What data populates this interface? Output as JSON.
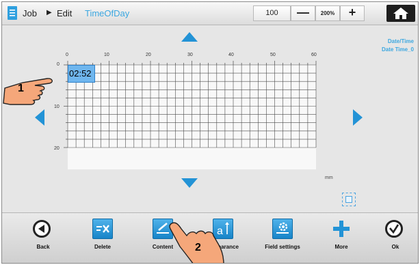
{
  "header": {
    "crumb_job": "Job",
    "crumb_arrow": "▶",
    "crumb_edit": "Edit",
    "job_name": "TimeOfDay",
    "zoom_value": "100",
    "zoom_minus": "—",
    "zoom_200": "200%",
    "zoom_plus": "+"
  },
  "side_info": {
    "line1": "Date/Time",
    "line2": "Date Time_0"
  },
  "ruler": {
    "x_ticks": [
      "0",
      "10",
      "20",
      "30",
      "40",
      "50",
      "60"
    ],
    "y_ticks": [
      "0",
      "10",
      "20"
    ],
    "unit": "mm"
  },
  "field": {
    "value": "02:52"
  },
  "toolbar": {
    "back": "Back",
    "delete": "Delete",
    "content": "Content",
    "appearance": "Appearance",
    "field_settings": "Field settings",
    "more": "More",
    "ok": "Ok"
  },
  "callouts": {
    "one": "1",
    "two": "2"
  },
  "colors": {
    "accent": "#3ba7e0",
    "arrow": "#2393d6",
    "selection": "#6fb6ee",
    "callout_hand": "#f5a77a"
  }
}
